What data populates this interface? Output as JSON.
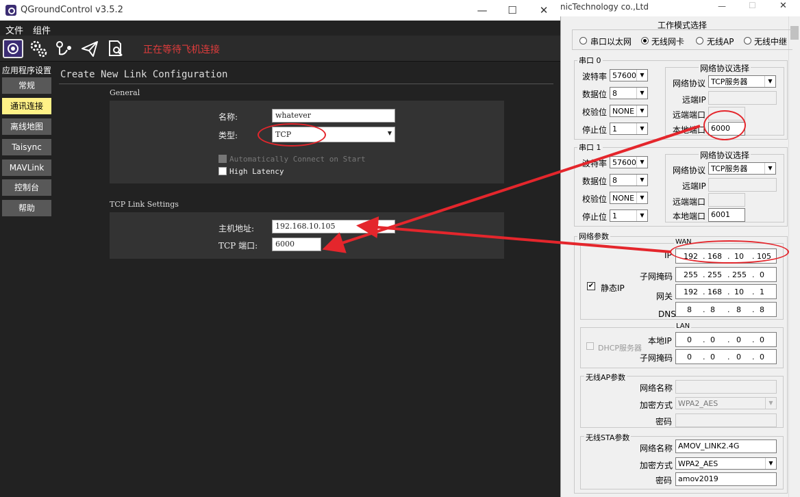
{
  "qgc": {
    "title": "QGroundControl v3.5.2",
    "menu": [
      "文件",
      "组件"
    ],
    "status": "正在等待飞机连接",
    "sidebar_title": "应用程序设置",
    "sidebar": [
      "常规",
      "通讯连接",
      "离线地图",
      "Taisync",
      "MAVLink",
      "控制台",
      "帮助"
    ],
    "page_title": "Create New Link Configuration",
    "general_label": "General",
    "name_label": "名称:",
    "name_value": "whatever",
    "type_label": "类型:",
    "type_value": "TCP",
    "auto_connect": "Automatically Connect on Start",
    "high_latency": "High Latency",
    "tcp_label": "TCP Link Settings",
    "host_label": "主机地址:",
    "host_value": "192.168.10.105",
    "port_label": "TCP 端口:",
    "port_value": "6000"
  },
  "cfg": {
    "title": "nicTechnology co.,Ltd",
    "mode_title": "工作模式选择",
    "modes": [
      "串口以太网",
      "无线网卡",
      "无线AP",
      "无线中继"
    ],
    "serial0": {
      "title": "串口 0",
      "baud_label": "波特率",
      "baud": "57600",
      "data_label": "数据位",
      "data": "8",
      "parity_label": "校验位",
      "parity": "NONE",
      "stop_label": "停止位",
      "stop": "1",
      "net_title": "网络协议选择",
      "proto_label": "网络协议",
      "proto": "TCP服务器",
      "rip_label": "远端IP",
      "rport_label": "远端端口",
      "lport_label": "本地端口",
      "lport": "6000"
    },
    "serial1": {
      "title": "串口 1",
      "baud_label": "波特率",
      "baud": "57600",
      "data_label": "数据位",
      "data": "8",
      "parity_label": "校验位",
      "parity": "NONE",
      "stop_label": "停止位",
      "stop": "1",
      "net_title": "网络协议选择",
      "proto_label": "网络协议",
      "proto": "TCP服务器",
      "rip_label": "远端IP",
      "rport_label": "远端端口",
      "lport_label": "本地端口",
      "lport": "6001"
    },
    "net": {
      "title": "网络参数",
      "wan": "WAN",
      "ip_label": "IP",
      "ip": [
        "192",
        "168",
        "10",
        "105"
      ],
      "mask_label": "子网掩码",
      "mask": [
        "255",
        "255",
        "255",
        "0"
      ],
      "gw_label": "网关",
      "gw": [
        "192",
        "168",
        "10",
        "1"
      ],
      "dns_label": "DNS",
      "dns": [
        "8",
        "8",
        "8",
        "8"
      ],
      "static_ip": "静态IP",
      "lan": "LAN",
      "dhcp": "DHCP服务器",
      "lanip_label": "本地IP",
      "lanip": [
        "0",
        "0",
        "0",
        "0"
      ],
      "lanmask_label": "子网掩码",
      "lanmask": [
        "0",
        "0",
        "0",
        "0"
      ]
    },
    "ap": {
      "title": "无线AP参数",
      "ssid_label": "网络名称",
      "enc_label": "加密方式",
      "enc": "WPA2_AES",
      "pwd_label": "密码"
    },
    "sta": {
      "title": "无线STA参数",
      "ssid_label": "网络名称",
      "ssid": "AMOV_LINK2.4G",
      "enc_label": "加密方式",
      "enc": "WPA2_AES",
      "pwd_label": "密码",
      "pwd": "amov2019"
    }
  },
  "colors": {
    "annotation": "#e4262c",
    "accent": "#fff187",
    "qgc_purple": "#3b2d73"
  }
}
